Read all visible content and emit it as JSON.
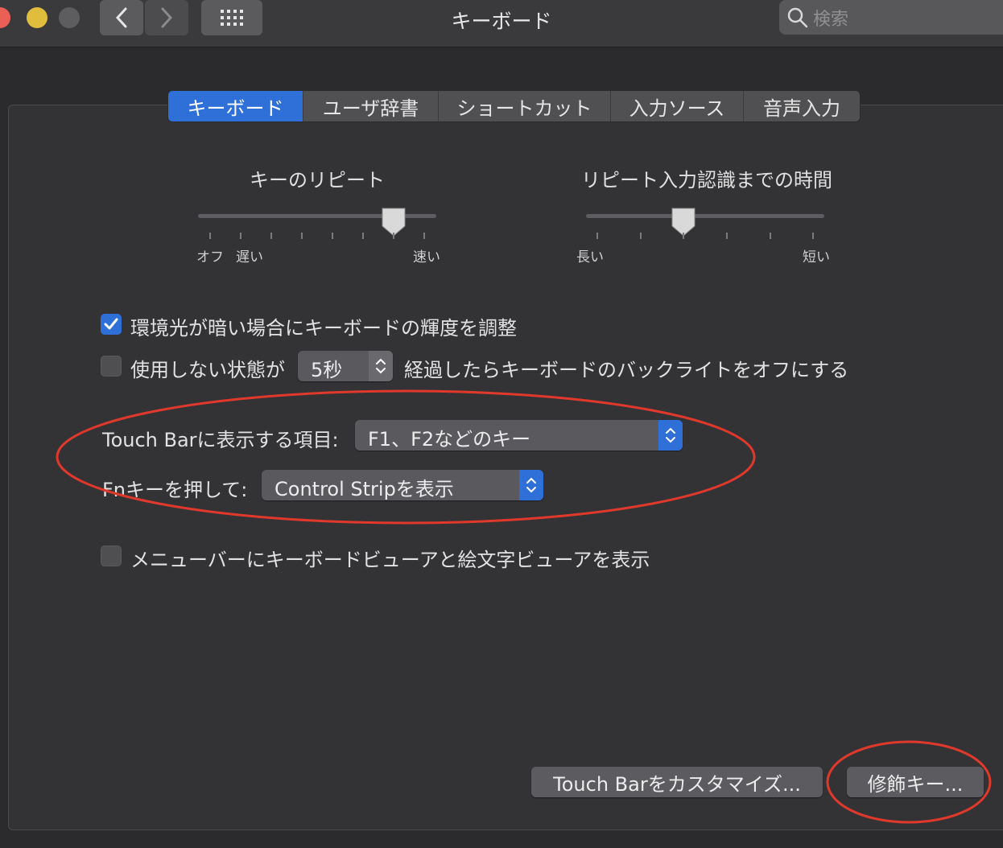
{
  "window": {
    "title": "キーボード"
  },
  "search": {
    "placeholder": "検索"
  },
  "tabs": [
    {
      "label": "キーボード",
      "active": true
    },
    {
      "label": "ユーザ辞書",
      "active": false
    },
    {
      "label": "ショートカット",
      "active": false
    },
    {
      "label": "入力ソース",
      "active": false
    },
    {
      "label": "音声入力",
      "active": false
    }
  ],
  "key_repeat": {
    "title": "キーのリピート",
    "label_off": "オフ",
    "label_slow": "遅い",
    "label_fast": "速い",
    "level_fraction": 0.82
  },
  "repeat_delay": {
    "title": "リピート入力認識までの時間",
    "label_long": "長い",
    "label_short": "短い",
    "level_fraction": 0.41
  },
  "options": {
    "adjust_brightness": {
      "label": "環境光が暗い場合にキーボードの輝度を調整",
      "checked": true
    },
    "backlight_off": {
      "prefix": "使用しない状態が",
      "value": "5秒",
      "suffix": "経過したらキーボードのバックライトをオフにする",
      "checked": false
    },
    "touchbar_shows": {
      "label": "Touch Barに表示する項目:",
      "value": "F1、F2などのキー"
    },
    "fn_press": {
      "label": "Fnキーを押して:",
      "value": "Control Stripを表示"
    },
    "menu_viewer": {
      "label": "メニューバーにキーボードビューアと絵文字ビューアを表示",
      "checked": false
    }
  },
  "buttons": {
    "customize_touchbar": "Touch Barをカスタマイズ...",
    "modifier_keys": "修飾キー..."
  },
  "colors": {
    "accent": "#2f6fd8",
    "annotation": "#e0392b"
  }
}
